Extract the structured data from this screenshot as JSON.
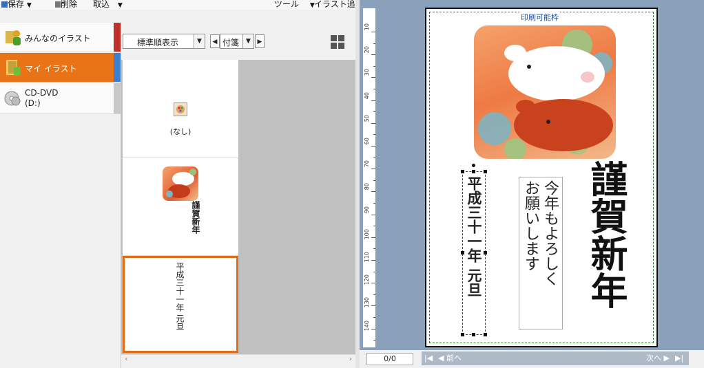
{
  "toolbar": {
    "save_label": "保存",
    "delete_label": "削除",
    "import_label": "取込",
    "tools_label": "ツール",
    "add_illust_label": "イラスト追加"
  },
  "categories": [
    {
      "label": "みんなのイラスト",
      "strip_color": "#c0302a"
    },
    {
      "label": "マイ イラスト",
      "strip_color": "#3a7fd0",
      "active": true
    },
    {
      "label_line1": "CD-DVD",
      "label_line2": "(D:)"
    }
  ],
  "list": {
    "sort_label": "標準順表示",
    "tag_label": "付箋",
    "none_label": "(なし)",
    "thumb_greeting": "謹賀新年",
    "thumb_date": "平成三十一年 元旦"
  },
  "preview": {
    "print_area_label": "印刷可能枠",
    "greeting_main": "謹賀新年",
    "message": [
      "今年もよろしく",
      "お願いします"
    ],
    "date": "平成三十一年 元旦",
    "ruler_labels": [
      "10",
      "20",
      "30",
      "40",
      "50",
      "60",
      "70",
      "80",
      "90",
      "100",
      "110",
      "120",
      "130",
      "140"
    ]
  },
  "status": {
    "page_counter": "0/0",
    "prev_label": "前へ",
    "next_label": "次へ"
  },
  "colors": {
    "accent_orange": "#e87417",
    "preview_bg": "#8aa0bb",
    "print_frame": "#2b7a2b"
  }
}
